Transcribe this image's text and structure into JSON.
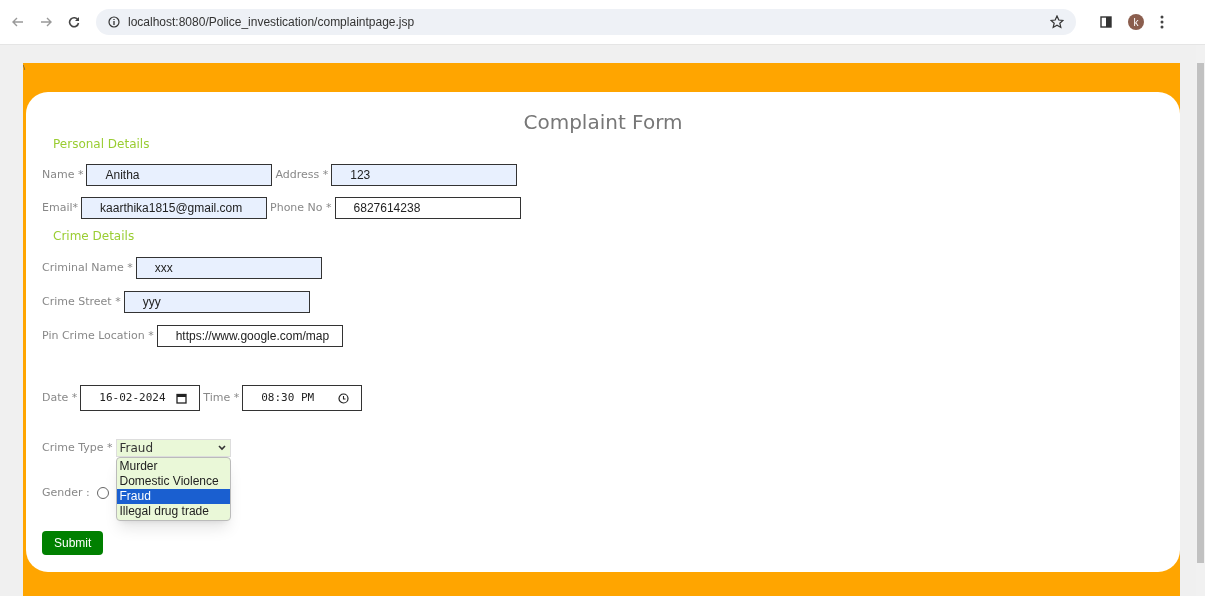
{
  "browser": {
    "url": "localhost:8080/Police_investication/complaintpage.jsp",
    "profile_initial": "k"
  },
  "page": {
    "corner_mark": "\\",
    "title": "Complaint Form",
    "sections": [
      {
        "heading": "Personal Details",
        "rows": [
          [
            {
              "kind": "text",
              "label": "Name *",
              "value": "Anitha",
              "filled": true
            },
            {
              "kind": "text",
              "label": "Address *",
              "value": "123",
              "filled": true
            }
          ],
          [
            {
              "kind": "text",
              "label": "Email*",
              "value": "kaarthika1815@gmail.com",
              "filled": true
            },
            {
              "kind": "text",
              "label": "Phone No *",
              "value": "6827614238",
              "filled": false
            }
          ]
        ]
      },
      {
        "heading": "Crime Details",
        "rows": [
          [
            {
              "kind": "text",
              "label": "Criminal Name *",
              "value": "xxx",
              "filled": true
            }
          ],
          [
            {
              "kind": "text",
              "label": "Crime Street *",
              "value": "yyy",
              "filled": true
            }
          ],
          [
            {
              "kind": "text",
              "label": "Pin Crime Location *",
              "value": "https://www.google.com/map",
              "filled": false
            }
          ],
          [
            {
              "kind": "date",
              "label": "Date *",
              "value": "16-02-2024"
            },
            {
              "kind": "time",
              "label": "Time *",
              "value": "08:30 PM"
            }
          ],
          [
            {
              "kind": "select",
              "label": "Crime Type *",
              "value": "Fraud",
              "expanded": true,
              "options": [
                {
                  "label": "Murder",
                  "selected": false
                },
                {
                  "label": "Domestic Violence",
                  "selected": false
                },
                {
                  "label": "Fraud",
                  "selected": true
                },
                {
                  "label": "Illegal drug trade",
                  "selected": false
                }
              ]
            }
          ],
          [
            {
              "kind": "radio",
              "label": "Gender :",
              "checked": false
            }
          ]
        ]
      }
    ],
    "submit": "Submit"
  }
}
